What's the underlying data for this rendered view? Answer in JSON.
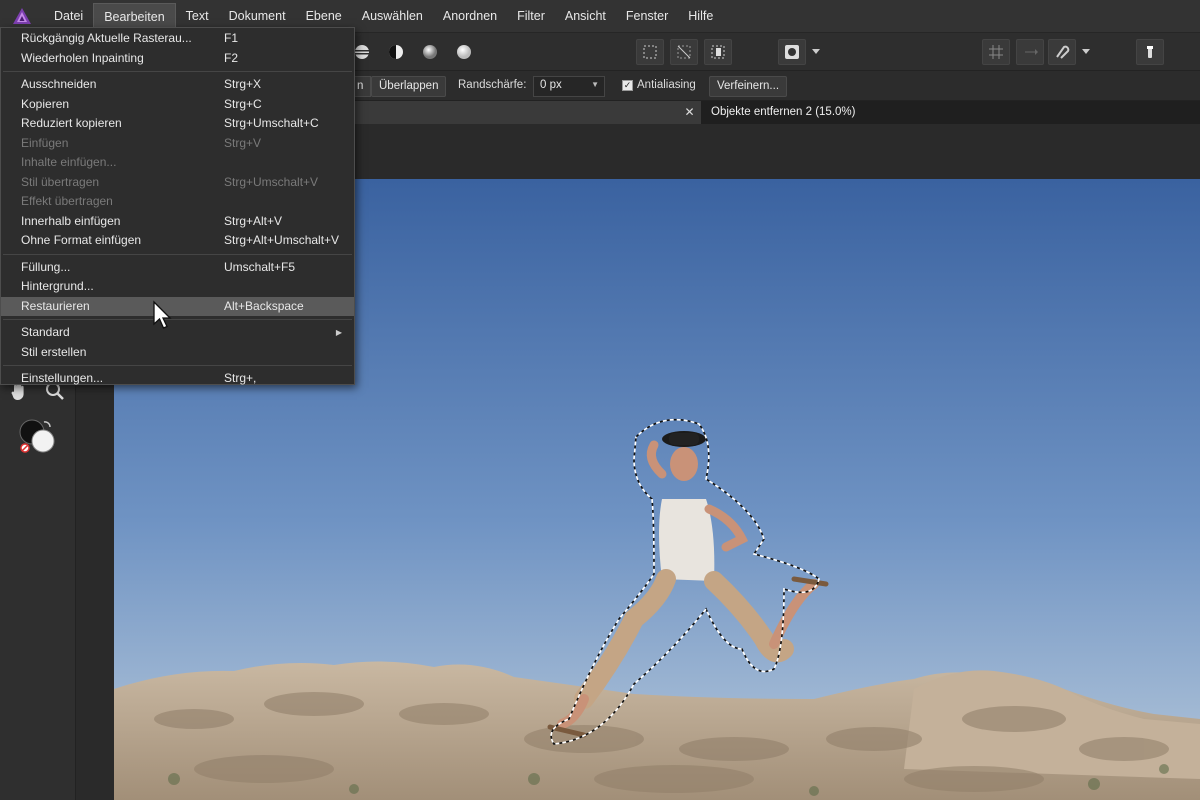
{
  "menubar": {
    "items": [
      "Datei",
      "Bearbeiten",
      "Text",
      "Dokument",
      "Ebene",
      "Auswählen",
      "Anordnen",
      "Filter",
      "Ansicht",
      "Fenster",
      "Hilfe"
    ],
    "active_index": 1
  },
  "edit_menu": {
    "items": [
      {
        "label": "Rückgängig Aktuelle Rasterau...",
        "shortcut": "F1"
      },
      {
        "label": "Wiederholen Inpainting",
        "shortcut": "F2"
      },
      {
        "label": "Ausschneiden",
        "shortcut": "Strg+X"
      },
      {
        "label": "Kopieren",
        "shortcut": "Strg+C"
      },
      {
        "label": "Reduziert kopieren",
        "shortcut": "Strg+Umschalt+C"
      },
      {
        "label": "Einfügen",
        "shortcut": "Strg+V"
      },
      {
        "label": "Inhalte einfügen...",
        "shortcut": ""
      },
      {
        "label": "Stil übertragen",
        "shortcut": "Strg+Umschalt+V"
      },
      {
        "label": "Effekt übertragen",
        "shortcut": ""
      },
      {
        "label": "Innerhalb einfügen",
        "shortcut": "Strg+Alt+V"
      },
      {
        "label": "Ohne Format einfügen",
        "shortcut": "Strg+Alt+Umschalt+V"
      },
      {
        "label": "Füllung...",
        "shortcut": "Umschalt+F5"
      },
      {
        "label": "Hintergrund...",
        "shortcut": ""
      },
      {
        "label": "Restaurieren",
        "shortcut": "Alt+Backspace"
      },
      {
        "label": "Standard",
        "shortcut": ""
      },
      {
        "label": "Stil erstellen",
        "shortcut": ""
      },
      {
        "label": "Einstellungen...",
        "shortcut": "Strg+,"
      }
    ]
  },
  "context_toolbar": {
    "partial_button": "n",
    "overlap_button": "Überlappen",
    "feather_label": "Randschärfe:",
    "feather_value": "0 px",
    "antialias_label": "Antialiasing",
    "antialias_checked": true,
    "refine_button": "Verfeinern..."
  },
  "document": {
    "tab_title": "Objekte entfernen 2 (15.0%)"
  },
  "colors": {
    "menubar_bg": "#333333",
    "highlight": "#5a5a5a",
    "sky_top": "#3a62a0",
    "sky_bottom": "#a9c1d9",
    "logo": "#8e44ad"
  }
}
